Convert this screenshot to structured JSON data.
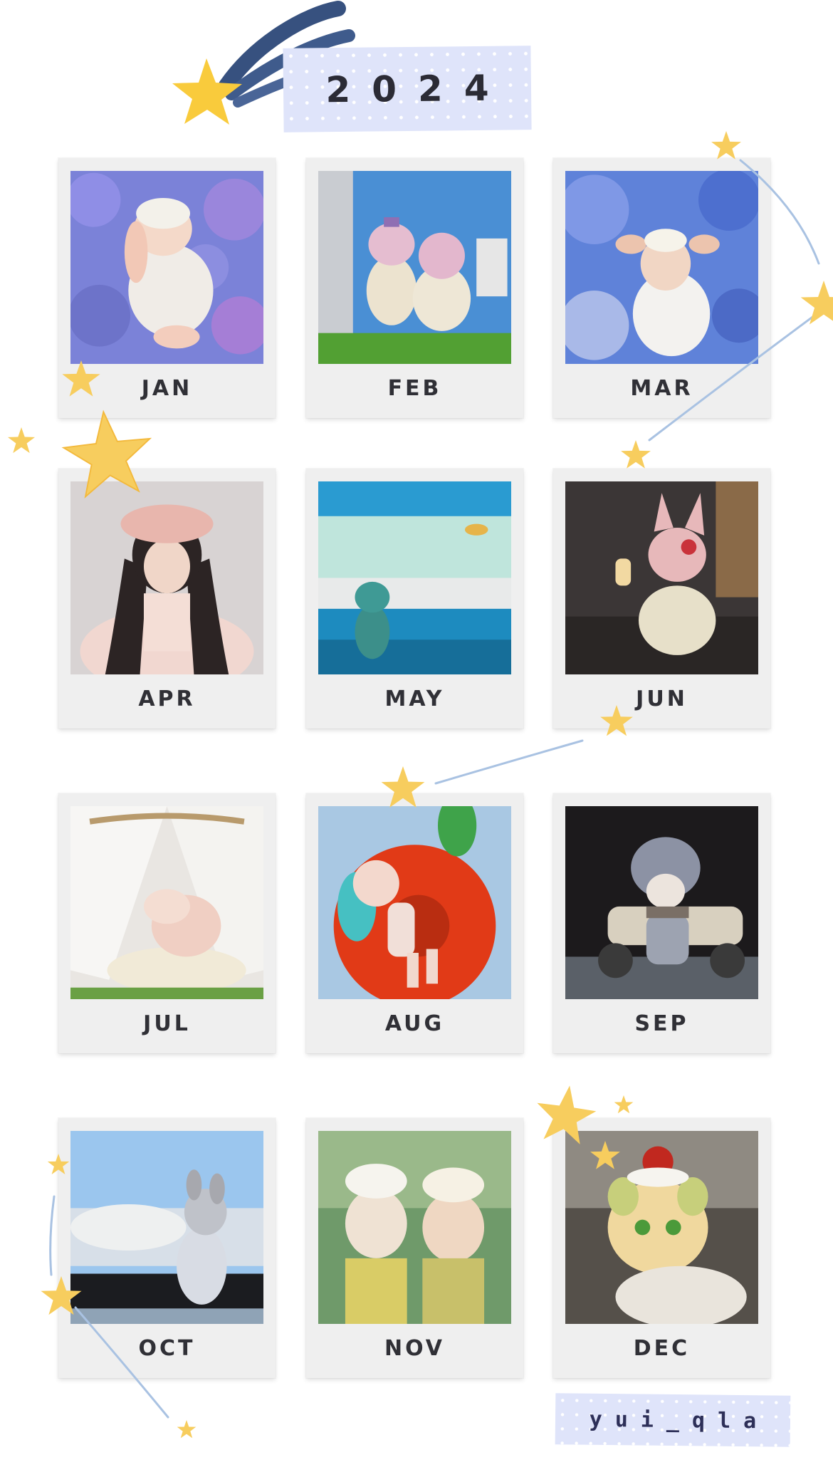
{
  "header": {
    "year": "2024",
    "shooting_star_icon": "shooting-star-icon"
  },
  "calendar": {
    "months": [
      {
        "label": "JAN",
        "photo": "doll-bunny-in-blue-hydrangeas"
      },
      {
        "label": "FEB",
        "photo": "two-cat-dolls-on-grass"
      },
      {
        "label": "MAR",
        "photo": "deer-doll-in-hydrangeas"
      },
      {
        "label": "APR",
        "photo": "doll-with-long-black-hair-in-pink-bonnet"
      },
      {
        "label": "MAY",
        "photo": "frog-doll-at-aquarium"
      },
      {
        "label": "JUN",
        "photo": "pink-cat-doll-with-popsicle"
      },
      {
        "label": "JUL",
        "photo": "doll-peeking-from-tent"
      },
      {
        "label": "AUG",
        "photo": "doll-on-red-swim-ring"
      },
      {
        "label": "SEP",
        "photo": "doll-in-fluffy-hat-with-scooter"
      },
      {
        "label": "OCT",
        "photo": "mouse-doll-by-window"
      },
      {
        "label": "NOV",
        "photo": "two-dolls-with-cream-hats"
      },
      {
        "label": "DEC",
        "photo": "bear-doll-with-cherry-hat"
      }
    ]
  },
  "footer": {
    "signature": "yui_qla"
  },
  "colors": {
    "star": "#f7cd5e",
    "tape": "#dfe4fa",
    "ink": "#2b2b35",
    "card": "#efefef"
  }
}
